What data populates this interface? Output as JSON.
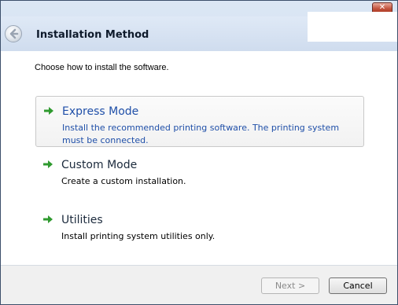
{
  "window": {
    "close_glyph": "✕"
  },
  "header": {
    "title": "Installation Method",
    "back_icon": "back-arrow-icon"
  },
  "content": {
    "prompt": "Choose how to install the software.",
    "options": [
      {
        "title": "Express Mode",
        "description": "Install the recommended printing software. The printing system must be connected.",
        "selected": true,
        "icon": "green-arrow-icon"
      },
      {
        "title": "Custom Mode",
        "description": "Create a custom installation.",
        "selected": false,
        "icon": "green-arrow-icon"
      },
      {
        "title": "Utilities",
        "description": "Install printing system utilities only.",
        "selected": false,
        "icon": "green-arrow-icon"
      }
    ]
  },
  "footer": {
    "next_label": "Next >",
    "next_enabled": false,
    "cancel_label": "Cancel"
  },
  "colors": {
    "selected_text": "#1f4fa8",
    "arrow_green": "#2f9a2f"
  }
}
